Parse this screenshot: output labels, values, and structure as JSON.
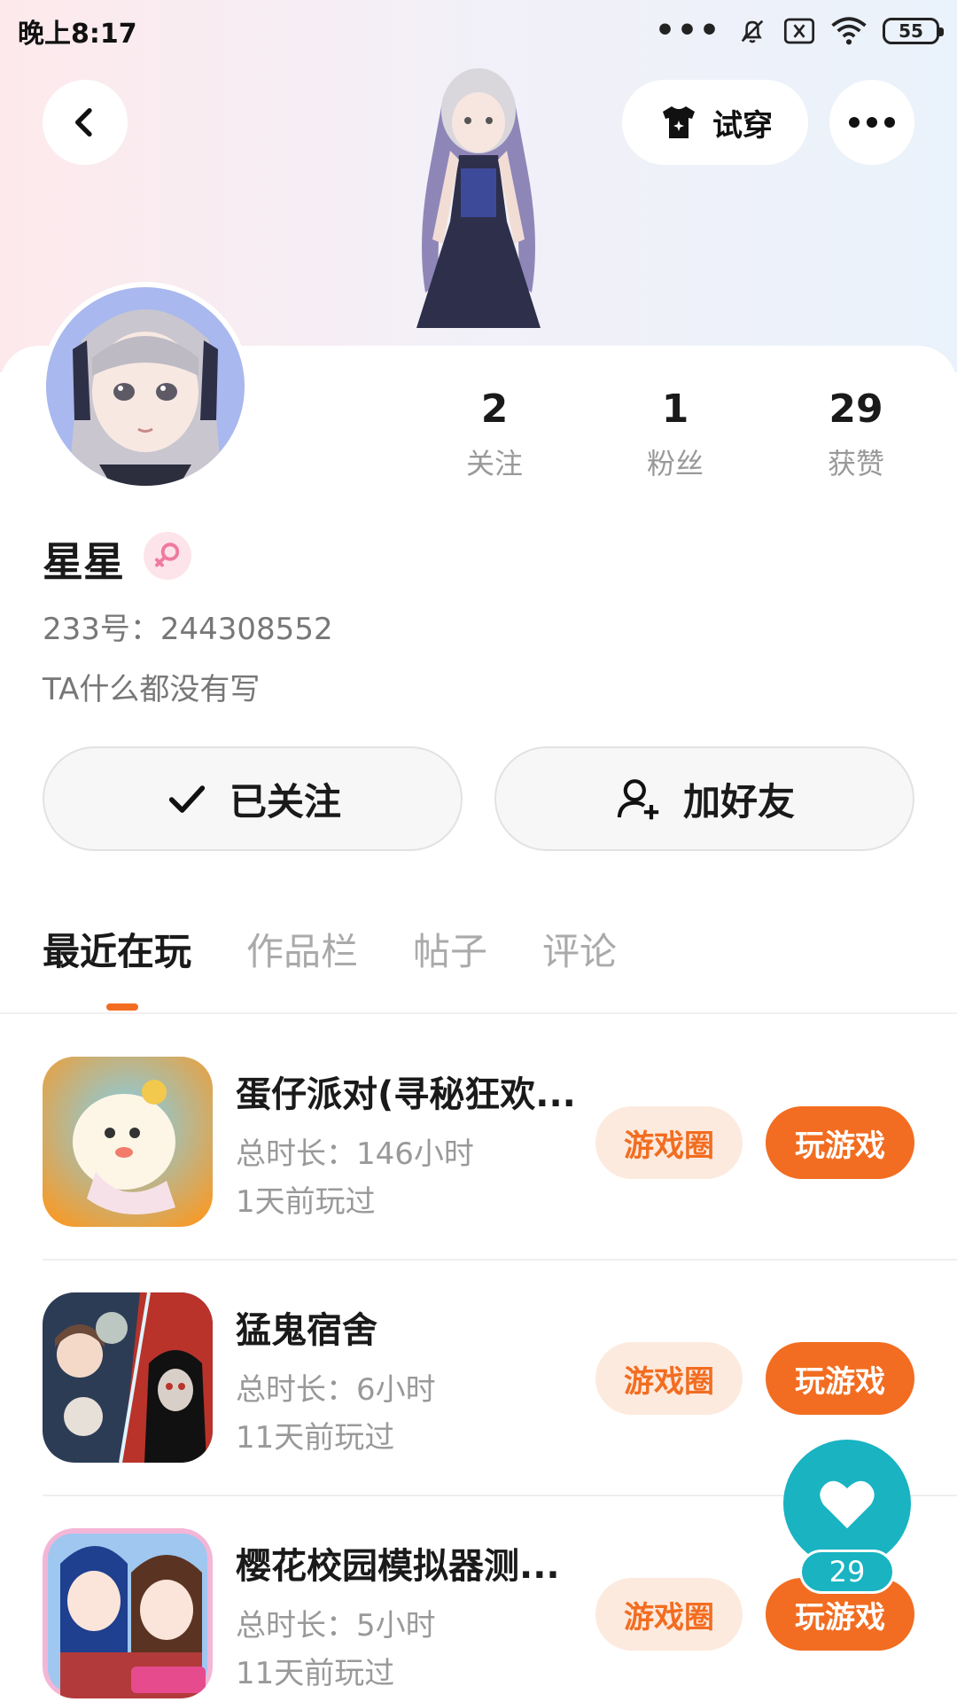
{
  "status_bar": {
    "time": "晚上8:17",
    "battery": "55"
  },
  "header": {
    "try_on_label": "试穿"
  },
  "profile": {
    "stats": [
      {
        "value": "2",
        "label": "关注"
      },
      {
        "value": "1",
        "label": "粉丝"
      },
      {
        "value": "29",
        "label": "获赞"
      }
    ],
    "name": "星星",
    "gender": "female",
    "uid": "233号：244308552",
    "bio": "TA什么都没有写"
  },
  "actions": {
    "followed_label": "已关注",
    "add_friend_label": "加好友"
  },
  "tabs": [
    {
      "label": "最近在玩",
      "active": true
    },
    {
      "label": "作品栏",
      "active": false
    },
    {
      "label": "帖子",
      "active": false
    },
    {
      "label": "评论",
      "active": false
    }
  ],
  "games": [
    {
      "name": "蛋仔派对(寻秘狂欢...",
      "total_time": "总时长：146小时",
      "last_played": "1天前玩过",
      "circle_label": "游戏圈",
      "play_label": "玩游戏"
    },
    {
      "name": "猛鬼宿舍",
      "total_time": "总时长：6小时",
      "last_played": "11天前玩过",
      "circle_label": "游戏圈",
      "play_label": "玩游戏"
    },
    {
      "name": "樱花校园模拟器测...",
      "total_time": "总时长：5小时",
      "last_played": "11天前玩过",
      "circle_label": "游戏圈",
      "play_label": "玩游戏"
    }
  ],
  "like_fab": {
    "count": "29"
  },
  "colors": {
    "accent": "#f26d21",
    "accent_light": "#fdeade",
    "fab": "#19b3c2",
    "female": "#f07aa0"
  }
}
